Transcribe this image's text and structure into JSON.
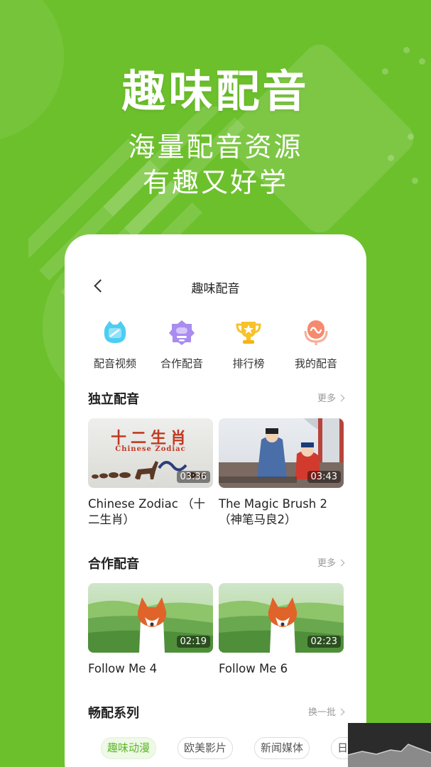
{
  "hero": {
    "title": "趣味配音",
    "subtitle_line1": "海量配音资源",
    "subtitle_line2": "有趣又好学"
  },
  "colors": {
    "background": "#6cc02c",
    "accent_green": "#5cb52a",
    "card": "#ffffff"
  },
  "nav": {
    "title": "趣味配音",
    "back_icon": "back-chevron-icon"
  },
  "quick_actions": [
    {
      "label": "配音视频",
      "icon": "tv-icon",
      "color": "#4dcdf2"
    },
    {
      "label": "合作配音",
      "icon": "partner-icon",
      "color": "#a98cf0"
    },
    {
      "label": "排行榜",
      "icon": "trophy-icon",
      "color": "#f7c22a"
    },
    {
      "label": "我的配音",
      "icon": "microphone-icon",
      "color": "#f58a6e"
    }
  ],
  "sections": {
    "solo": {
      "title": "独立配音",
      "more": "更多",
      "videos": [
        {
          "title": "Chinese Zodiac （十二生肖）",
          "duration": "03:36",
          "thumb_heading": "十二生肖",
          "thumb_subheading": "Chinese Zodiac"
        },
        {
          "title": "The Magic Brush 2（神笔马良2）",
          "duration": "03:43"
        }
      ]
    },
    "coop": {
      "title": "合作配音",
      "more": "更多",
      "videos": [
        {
          "title": "Follow Me 4",
          "duration": "02:19"
        },
        {
          "title": "Follow Me 6",
          "duration": "02:23"
        }
      ]
    },
    "series": {
      "title": "畅配系列",
      "refresh": "换一批",
      "chips": [
        "趣味动漫",
        "欧美影片",
        "新闻媒体",
        "日"
      ],
      "active_chip": "趣味动漫"
    }
  }
}
